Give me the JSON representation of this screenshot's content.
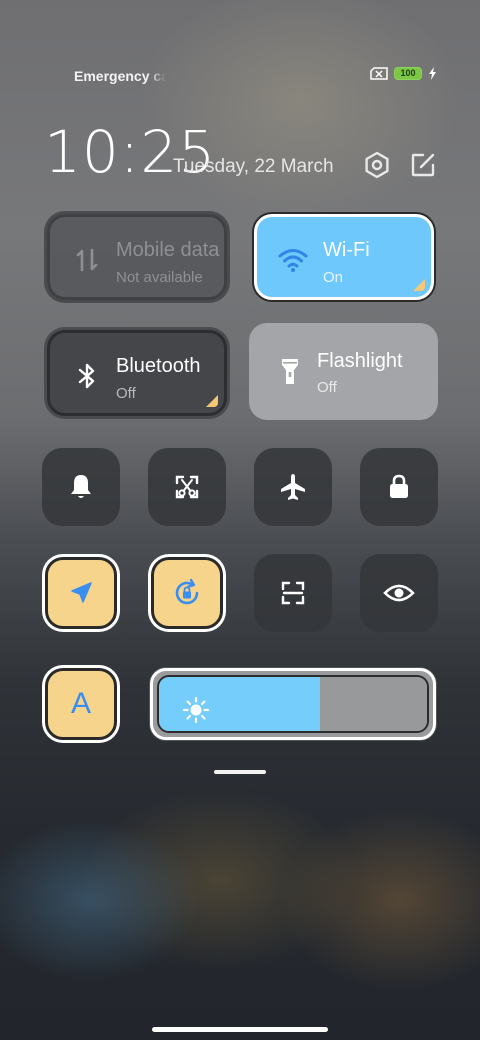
{
  "status": {
    "carrier_text": "Emergency calls only",
    "battery_level": "100"
  },
  "header": {
    "time": "10:25",
    "date": "Tuesday, 22 March"
  },
  "tiles": {
    "mobile_data": {
      "title": "Mobile data",
      "subtitle": "Not available"
    },
    "wifi": {
      "title": "Wi-Fi",
      "subtitle": "On"
    },
    "bluetooth": {
      "title": "Bluetooth",
      "subtitle": "Off"
    },
    "flashlight": {
      "title": "Flashlight",
      "subtitle": "Off"
    }
  },
  "toggles": [
    {
      "icon": "bell-icon",
      "active": false
    },
    {
      "icon": "screenshot-icon",
      "active": false
    },
    {
      "icon": "airplane-icon",
      "active": false
    },
    {
      "icon": "lock-icon",
      "active": false
    },
    {
      "icon": "location-icon",
      "active": true
    },
    {
      "icon": "rotation-lock-icon",
      "active": true
    },
    {
      "icon": "scanner-icon",
      "active": false
    },
    {
      "icon": "eye-icon",
      "active": false
    }
  ],
  "auto_brightness": {
    "label": "A",
    "active": true
  },
  "brightness": {
    "level": 0.6
  },
  "colors": {
    "accent_blue": "#74cdfb",
    "active_yellow": "#f7d48c",
    "icon_blue": "#3a8ef0"
  }
}
